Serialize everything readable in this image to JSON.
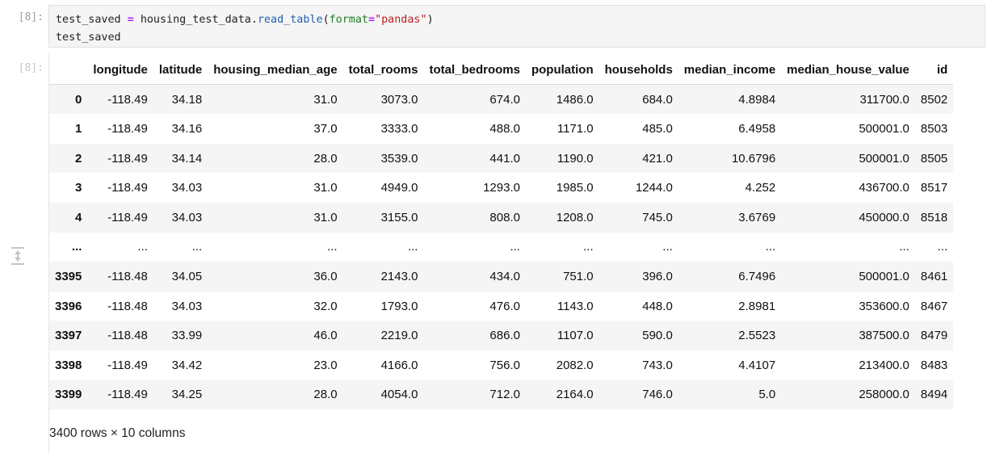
{
  "cell": {
    "prompt_in": "[8]:",
    "prompt_out": "[8]:",
    "code": {
      "line1": {
        "var": "test_saved",
        "op": "=",
        "obj": "housing_test_data.",
        "method": "read_table",
        "open": "(",
        "kwarg": "format",
        "eq": "=",
        "str": "\"pandas\"",
        "close": ")"
      },
      "line2": "test_saved"
    }
  },
  "table": {
    "columns": [
      "",
      "longitude",
      "latitude",
      "housing_median_age",
      "total_rooms",
      "total_bedrooms",
      "population",
      "households",
      "median_income",
      "median_house_value",
      "id"
    ],
    "rows": [
      [
        "0",
        "-118.49",
        "34.18",
        "31.0",
        "3073.0",
        "674.0",
        "1486.0",
        "684.0",
        "4.8984",
        "311700.0",
        "8502"
      ],
      [
        "1",
        "-118.49",
        "34.16",
        "37.0",
        "3333.0",
        "488.0",
        "1171.0",
        "485.0",
        "6.4958",
        "500001.0",
        "8503"
      ],
      [
        "2",
        "-118.49",
        "34.14",
        "28.0",
        "3539.0",
        "441.0",
        "1190.0",
        "421.0",
        "10.6796",
        "500001.0",
        "8505"
      ],
      [
        "3",
        "-118.49",
        "34.03",
        "31.0",
        "4949.0",
        "1293.0",
        "1985.0",
        "1244.0",
        "4.252",
        "436700.0",
        "8517"
      ],
      [
        "4",
        "-118.49",
        "34.03",
        "31.0",
        "3155.0",
        "808.0",
        "1208.0",
        "745.0",
        "3.6769",
        "450000.0",
        "8518"
      ],
      [
        "...",
        "...",
        "...",
        "...",
        "...",
        "...",
        "...",
        "...",
        "...",
        "...",
        "..."
      ],
      [
        "3395",
        "-118.48",
        "34.05",
        "36.0",
        "2143.0",
        "434.0",
        "751.0",
        "396.0",
        "6.7496",
        "500001.0",
        "8461"
      ],
      [
        "3396",
        "-118.48",
        "34.03",
        "32.0",
        "1793.0",
        "476.0",
        "1143.0",
        "448.0",
        "2.8981",
        "353600.0",
        "8467"
      ],
      [
        "3397",
        "-118.48",
        "33.99",
        "46.0",
        "2219.0",
        "686.0",
        "1107.0",
        "590.0",
        "2.5523",
        "387500.0",
        "8479"
      ],
      [
        "3398",
        "-118.49",
        "34.42",
        "23.0",
        "4166.0",
        "756.0",
        "2082.0",
        "743.0",
        "4.4107",
        "213400.0",
        "8483"
      ],
      [
        "3399",
        "-118.49",
        "34.25",
        "28.0",
        "4054.0",
        "712.0",
        "2164.0",
        "746.0",
        "5.0",
        "258000.0",
        "8494"
      ]
    ],
    "shape_text": "3400 rows × 10 columns"
  }
}
